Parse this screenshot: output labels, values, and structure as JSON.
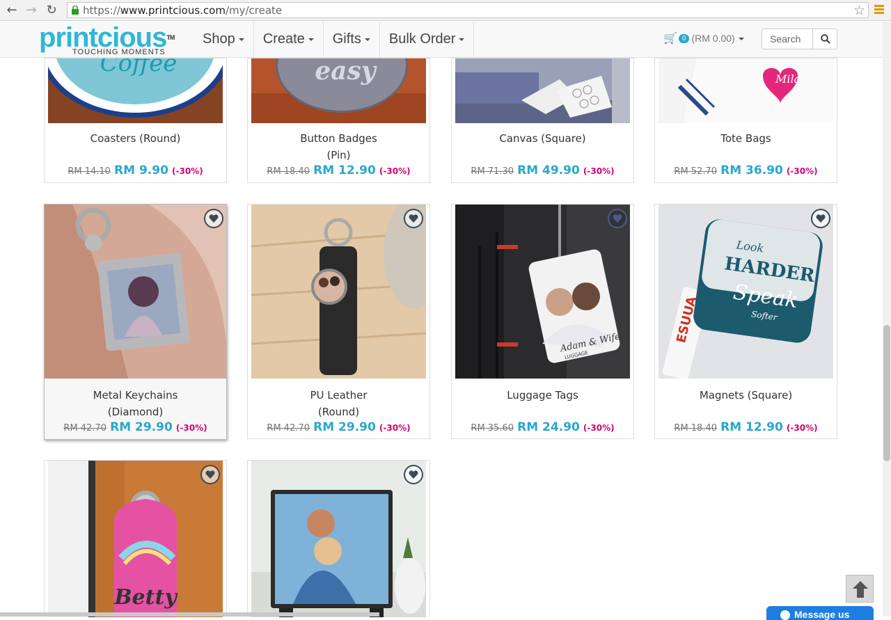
{
  "browser": {
    "url_scheme": "https://",
    "url_host": "www.printcious.com",
    "url_path": "/my/create"
  },
  "header": {
    "logo": "printcious",
    "logo_tm": "TM",
    "logo_tagline": "TOUCHING MOMENTS",
    "nav": [
      "Shop",
      "Create",
      "Gifts",
      "Bulk Order"
    ],
    "cart_count": "0",
    "cart_total": "(RM 0.00)",
    "search_placeholder": "Search"
  },
  "products": [
    {
      "name": "Coasters (Round)",
      "old_price": "RM 14.10",
      "price": "RM 9.90",
      "discount": "(-30%)",
      "image": "coffee-coaster"
    },
    {
      "name": "Button Badges\n(Pin)",
      "old_price": "RM 18.40",
      "price": "RM 12.90",
      "discount": "(-30%)",
      "image": "easy-badge"
    },
    {
      "name": "Canvas (Square)",
      "old_price": "RM 71.30",
      "price": "RM 49.90",
      "discount": "(-30%)",
      "image": "sofa-canvas"
    },
    {
      "name": "Tote Bags",
      "old_price": "RM 52.70",
      "price": "RM 36.90",
      "discount": "(-30%)",
      "image": "mila-tote"
    },
    {
      "name": "Metal Keychains\n(Diamond)",
      "old_price": "RM 42.70",
      "price": "RM 29.90",
      "discount": "(-30%)",
      "image": "metal-keychain"
    },
    {
      "name": "PU Leather\n(Round)",
      "old_price": "RM 42.70",
      "price": "RM 29.90",
      "discount": "(-30%)",
      "image": "leather-keychain"
    },
    {
      "name": "Luggage Tags",
      "old_price": "RM 35.60",
      "price": "RM 24.90",
      "discount": "(-30%)",
      "image": "luggage-tag"
    },
    {
      "name": "Magnets (Square)",
      "old_price": "RM 18.40",
      "price": "RM 12.90",
      "discount": "(-30%)",
      "image": "magnet-square"
    },
    {
      "name": "",
      "image": "door-hanger",
      "image_text": "Betty"
    },
    {
      "name": "",
      "image": "photo-slate"
    }
  ],
  "image_text": {
    "coaster": "Coffee",
    "badge": "easy",
    "tote": "Mila",
    "luggage": "Adam & Wife",
    "luggage_sub": "LUGGAGE",
    "magnet_1": "Look",
    "magnet_2": "HARDER",
    "magnet_3": "Speak",
    "magnet_4": "Softer",
    "marker": "ESUUA",
    "door": "Betty"
  },
  "widgets": {
    "messenger_label": "Message us"
  }
}
